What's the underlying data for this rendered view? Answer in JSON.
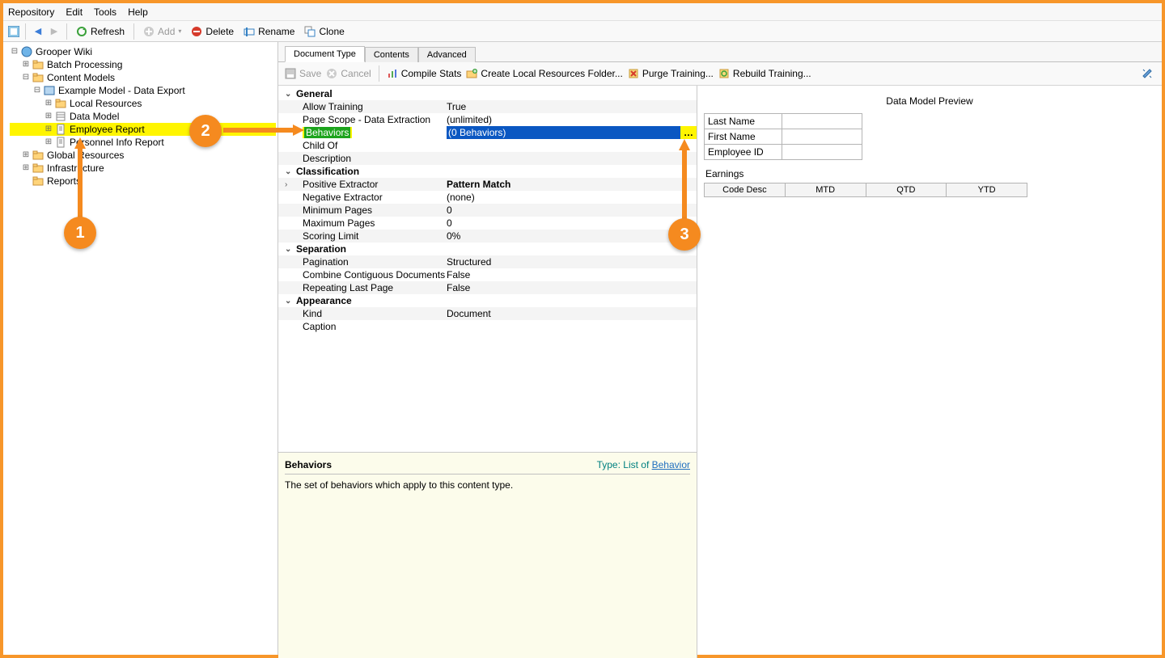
{
  "menu": {
    "repository": "Repository",
    "edit": "Edit",
    "tools": "Tools",
    "help": "Help"
  },
  "toolbar": {
    "refresh": "Refresh",
    "add": "Add",
    "delete": "Delete",
    "rename": "Rename",
    "clone": "Clone"
  },
  "tree": {
    "root": "Grooper Wiki",
    "batch": "Batch Processing",
    "content": "Content Models",
    "example": "Example Model - Data Export",
    "local": "Local Resources",
    "datamodel": "Data Model",
    "employee": "Employee Report",
    "personnel": "Personnel Info Report",
    "global": "Global Resources",
    "infra": "Infrastructure",
    "reports": "Reports"
  },
  "tabs": {
    "doc": "Document Type",
    "contents": "Contents",
    "advanced": "Advanced"
  },
  "actions": {
    "save": "Save",
    "cancel": "Cancel",
    "compile": "Compile Stats",
    "createLocal": "Create Local Resources Folder...",
    "purge": "Purge Training...",
    "rebuild": "Rebuild Training..."
  },
  "propgrid": {
    "general": "General",
    "allowTraining": {
      "k": "Allow Training",
      "v": "True"
    },
    "pageScope": {
      "k": "Page Scope - Data Extraction",
      "v": "(unlimited)"
    },
    "behaviors": {
      "k": "Behaviors",
      "v": "(0 Behaviors)"
    },
    "childOf": {
      "k": "Child Of",
      "v": ""
    },
    "description": {
      "k": "Description",
      "v": ""
    },
    "classification": "Classification",
    "posEx": {
      "k": "Positive Extractor",
      "v": "Pattern Match"
    },
    "negEx": {
      "k": "Negative Extractor",
      "v": "(none)"
    },
    "minPages": {
      "k": "Minimum Pages",
      "v": "0"
    },
    "maxPages": {
      "k": "Maximum Pages",
      "v": "0"
    },
    "scoring": {
      "k": "Scoring Limit",
      "v": "0%"
    },
    "separation": "Separation",
    "pagination": {
      "k": "Pagination",
      "v": "Structured"
    },
    "combine": {
      "k": "Combine Contiguous Documents",
      "v": "False"
    },
    "repeat": {
      "k": "Repeating Last Page",
      "v": "False"
    },
    "appearance": "Appearance",
    "kind": {
      "k": "Kind",
      "v": "Document"
    },
    "caption": {
      "k": "Caption",
      "v": ""
    }
  },
  "desc": {
    "title": "Behaviors",
    "typeLabel": "Type:",
    "listOf": "List of",
    "linkText": "Behavior",
    "body": "The set of behaviors which apply to this content type."
  },
  "preview": {
    "title": "Data Model Preview",
    "lastName": "Last Name",
    "firstName": "First Name",
    "empId": "Employee ID",
    "earnings": "Earnings",
    "cols": {
      "c1": "Code Desc",
      "c2": "MTD",
      "c3": "QTD",
      "c4": "YTD"
    }
  },
  "callouts": {
    "one": "1",
    "two": "2",
    "three": "3"
  }
}
